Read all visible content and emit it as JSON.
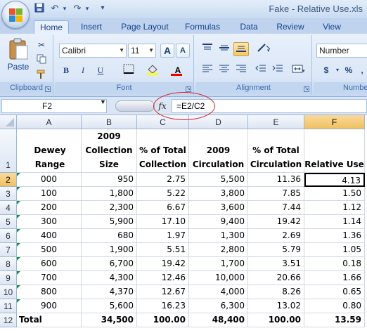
{
  "window": {
    "title": "Fake - Relative Use.xls"
  },
  "quick_access": [
    {
      "icon": "save-icon",
      "glyph": "💾"
    },
    {
      "icon": "undo-icon",
      "glyph": "↶"
    },
    {
      "icon": "redo-icon",
      "glyph": "↷"
    },
    {
      "icon": "customize-qat-icon",
      "glyph": "▾"
    }
  ],
  "tabs": [
    "Home",
    "Insert",
    "Page Layout",
    "Formulas",
    "Data",
    "Review",
    "View"
  ],
  "active_tab": "Home",
  "ribbon": {
    "clipboard": {
      "label": "Clipboard",
      "paste_label": "Paste"
    },
    "font": {
      "label": "Font",
      "font_name": "Calibri",
      "font_size": "11",
      "grow": "A",
      "shrink": "A",
      "bold": "B",
      "italic": "I",
      "underline": "U",
      "font_color": "A"
    },
    "alignment": {
      "label": "Alignment"
    },
    "number": {
      "label": "Numbe",
      "format": "Number",
      "currency": "$",
      "percent": "%",
      "comma": ","
    }
  },
  "formula_bar": {
    "name_box": "F2",
    "fx": "fx",
    "formula": "=E2/C2"
  },
  "sheet": {
    "columns": [
      "A",
      "B",
      "C",
      "D",
      "E",
      "F"
    ],
    "selected_column": "F",
    "selected_row": "2",
    "row_numbers": [
      "1",
      "2",
      "3",
      "4",
      "5",
      "6",
      "7",
      "8",
      "9",
      "10",
      "11",
      "12"
    ],
    "header_row": [
      "Dewey Range",
      "2009 Collection Size",
      "% of Total Collection",
      "2009 Circulation",
      "% of Total Circulation",
      "Relative Use"
    ],
    "rows": [
      [
        "000",
        "950",
        "2.75",
        "5,500",
        "11.36",
        "4.13"
      ],
      [
        "100",
        "1,800",
        "5.22",
        "3,800",
        "7.85",
        "1.50"
      ],
      [
        "200",
        "2,300",
        "6.67",
        "3,600",
        "7.44",
        "1.12"
      ],
      [
        "300",
        "5,900",
        "17.10",
        "9,400",
        "19.42",
        "1.14"
      ],
      [
        "400",
        "680",
        "1.97",
        "1,300",
        "2.69",
        "1.36"
      ],
      [
        "500",
        "1,900",
        "5.51",
        "2,800",
        "5.79",
        "1.05"
      ],
      [
        "600",
        "6,700",
        "19.42",
        "1,700",
        "3.51",
        "0.18"
      ],
      [
        "700",
        "4,300",
        "12.46",
        "10,000",
        "20.66",
        "1.66"
      ],
      [
        "800",
        "4,370",
        "12.67",
        "4,000",
        "8.26",
        "0.65"
      ],
      [
        "900",
        "5,600",
        "16.23",
        "6,300",
        "13.02",
        "0.80"
      ],
      [
        "Total",
        "34,500",
        "100.00",
        "48,400",
        "100.00",
        "13.59"
      ]
    ]
  },
  "colors": {
    "selection_header": "#f1c15f",
    "error_triangle": "#1f8a3a",
    "formula_highlight": "#d2232a"
  }
}
